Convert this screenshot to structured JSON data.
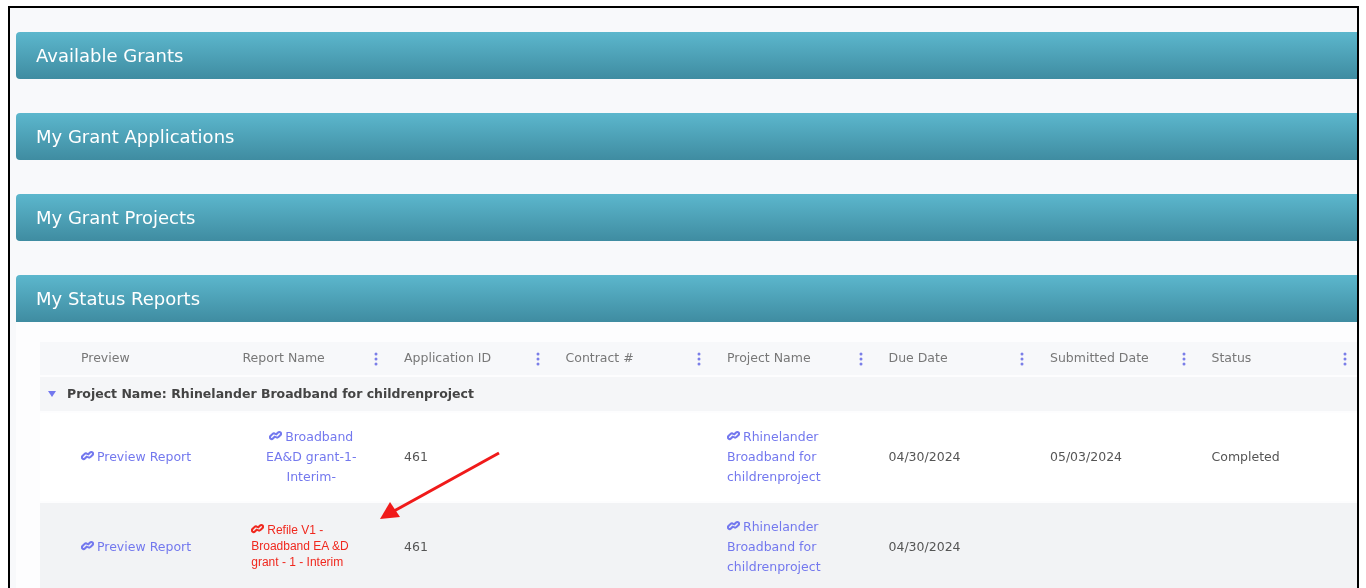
{
  "panels": [
    {
      "title": "Available Grants",
      "expanded": false
    },
    {
      "title": "My Grant Applications",
      "expanded": false
    },
    {
      "title": "My Grant Projects",
      "expanded": false
    },
    {
      "title": "My Status Reports",
      "expanded": true,
      "table": {
        "columns": [
          {
            "label": "Preview",
            "menu": false
          },
          {
            "label": "Report Name",
            "menu": true
          },
          {
            "label": "Application ID",
            "menu": true
          },
          {
            "label": "Contract #",
            "menu": true
          },
          {
            "label": "Project Name",
            "menu": true
          },
          {
            "label": "Due Date",
            "menu": true
          },
          {
            "label": "Submitted Date",
            "menu": true
          },
          {
            "label": "Status",
            "menu": true
          }
        ],
        "groups": [
          {
            "label": "Project Name: Rhinelander Broadband for childrenproject",
            "expanded": true,
            "rows": [
              {
                "flagged": false,
                "cells": [
                  {
                    "kind": "link",
                    "text": "Preview Report"
                  },
                  {
                    "kind": "link",
                    "text": "Broadband EA&D grant-1-Interim-"
                  },
                  {
                    "kind": "text",
                    "text": "461"
                  },
                  {
                    "kind": "empty"
                  },
                  {
                    "kind": "link",
                    "text": "Rhinelander Broadband for childrenproject"
                  },
                  {
                    "kind": "text",
                    "text": "04/30/2024"
                  },
                  {
                    "kind": "text",
                    "text": "05/03/2024"
                  },
                  {
                    "kind": "text",
                    "text": "Completed"
                  }
                ]
              },
              {
                "flagged": true,
                "cells": [
                  {
                    "kind": "link",
                    "text": "Preview Report"
                  },
                  {
                    "kind": "link",
                    "text": "Refile V1 - Broadband EA &D grant - 1 - Interim"
                  },
                  {
                    "kind": "text",
                    "text": "461"
                  },
                  {
                    "kind": "empty"
                  },
                  {
                    "kind": "link",
                    "text": "Rhinelander Broadband for childrenproject"
                  },
                  {
                    "kind": "text",
                    "text": "04/30/2024"
                  },
                  {
                    "kind": "empty"
                  },
                  {
                    "kind": "empty"
                  }
                ]
              }
            ]
          }
        ]
      }
    }
  ]
}
